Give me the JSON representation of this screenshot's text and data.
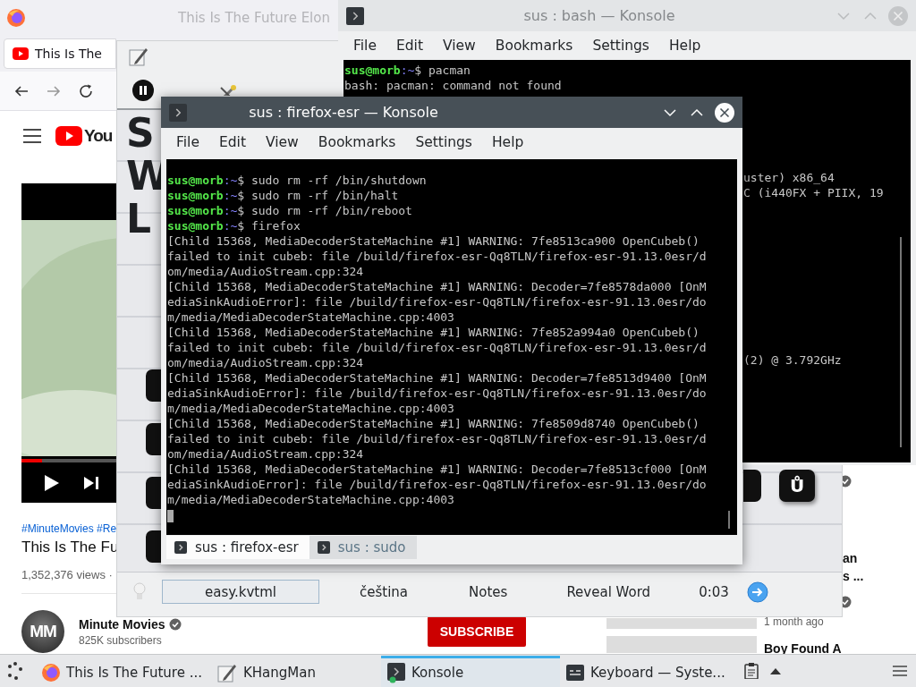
{
  "firefox": {
    "title": "This Is The Future Elon",
    "tab": "This Is The",
    "youtube": {
      "logo": "You",
      "video": {
        "kind": "picture",
        "level": 0.22
      },
      "hashtags": "#MinuteMovies #Re",
      "title": "This Is The Fu",
      "views": "1,352,376 views ·",
      "channel": {
        "avatar": "MM",
        "name": "Minute Movies",
        "verified": true,
        "subscribers": "825K subscribers"
      },
      "subscribe": "SUBSCRIBE",
      "sidebar": [
        {
          "verified": true
        },
        {
          "title_lines": [
            "an",
            "s ..."
          ],
          "verified": true,
          "age": "1 month ago"
        },
        {
          "title_lines": [
            "Boy Found A"
          ],
          "verified": false
        }
      ]
    }
  },
  "khangman": {
    "hint_words": [
      "S",
      "W",
      "L"
    ],
    "keys": [
      {
        "letter": "Ů"
      }
    ],
    "bottom_bar": {
      "file": "easy.kvtml",
      "language": "čeština",
      "notes": "Notes",
      "reveal": "Reveal Word",
      "timer": "0:03"
    }
  },
  "bash_konsole": {
    "title": "sus : bash — Konsole",
    "active": false,
    "menu": [
      "File",
      "Edit",
      "View",
      "Bookmarks",
      "Settings",
      "Help"
    ],
    "lines": [
      {
        "kind": "prompt",
        "user": "sus@morb",
        "path": ":~",
        "text": "$ pacman"
      },
      {
        "kind": "output",
        "text": "bash: pacman: command not found"
      }
    ],
    "fragments": [
      "uster) x86_64",
      "C (i440FX + PIIX, 19",
      "(2) @ 3.792GHz"
    ]
  },
  "front_konsole": {
    "title": "sus : firefox-esr — Konsole",
    "active": true,
    "menu": [
      "File",
      "Edit",
      "View",
      "Bookmarks",
      "Settings",
      "Help"
    ],
    "lines": [
      {
        "kind": "prompt",
        "user": "sus@morb",
        "path": ":~",
        "text": "$ sudo rm -rf /bin/shutdown"
      },
      {
        "kind": "prompt",
        "user": "sus@morb",
        "path": ":~",
        "text": "$ sudo rm -rf /bin/halt"
      },
      {
        "kind": "prompt",
        "user": "sus@morb",
        "path": ":~",
        "text": "$ sudo rm -rf /bin/reboot"
      },
      {
        "kind": "prompt",
        "user": "sus@morb",
        "path": ":~",
        "text": "$ firefox"
      },
      {
        "kind": "output",
        "text": "[Child 15368, MediaDecoderStateMachine #1] WARNING: 7fe8513ca900 OpenCubeb()"
      },
      {
        "kind": "output",
        "text": "failed to init cubeb: file /build/firefox-esr-Qq8TLN/firefox-esr-91.13.0esr/d"
      },
      {
        "kind": "output",
        "text": "om/media/AudioStream.cpp:324"
      },
      {
        "kind": "output",
        "text": "[Child 15368, MediaDecoderStateMachine #1] WARNING: Decoder=7fe8578da000 [OnM"
      },
      {
        "kind": "output",
        "text": "ediaSinkAudioError]: file /build/firefox-esr-Qq8TLN/firefox-esr-91.13.0esr/do"
      },
      {
        "kind": "output",
        "text": "m/media/MediaDecoderStateMachine.cpp:4003"
      },
      {
        "kind": "output",
        "text": "[Child 15368, MediaDecoderStateMachine #1] WARNING: 7fe852a994a0 OpenCubeb()"
      },
      {
        "kind": "output",
        "text": "failed to init cubeb: file /build/firefox-esr-Qq8TLN/firefox-esr-91.13.0esr/d"
      },
      {
        "kind": "output",
        "text": "om/media/AudioStream.cpp:324"
      },
      {
        "kind": "output",
        "text": "[Child 15368, MediaDecoderStateMachine #1] WARNING: Decoder=7fe8513d9400 [OnM"
      },
      {
        "kind": "output",
        "text": "ediaSinkAudioError]: file /build/firefox-esr-Qq8TLN/firefox-esr-91.13.0esr/do"
      },
      {
        "kind": "output",
        "text": "m/media/MediaDecoderStateMachine.cpp:4003"
      },
      {
        "kind": "output",
        "text": "[Child 15368, MediaDecoderStateMachine #1] WARNING: 7fe8509d8740 OpenCubeb()"
      },
      {
        "kind": "output",
        "text": "failed to init cubeb: file /build/firefox-esr-Qq8TLN/firefox-esr-91.13.0esr/d"
      },
      {
        "kind": "output",
        "text": "om/media/AudioStream.cpp:324"
      },
      {
        "kind": "output",
        "text": "[Child 15368, MediaDecoderStateMachine #1] WARNING: Decoder=7fe8513cf000 [OnM"
      },
      {
        "kind": "output",
        "text": "ediaSinkAudioError]: file /build/firefox-esr-Qq8TLN/firefox-esr-91.13.0esr/do"
      },
      {
        "kind": "output",
        "text": "m/media/MediaDecoderStateMachine.cpp:4003"
      }
    ],
    "tabs": [
      {
        "label": "sus : firefox-esr",
        "selected": true
      },
      {
        "label": "sus : sudo",
        "selected": false
      }
    ]
  },
  "taskbar": {
    "tasks": [
      {
        "kind": "browser",
        "label": "This Is The Future ...",
        "selected": false
      },
      {
        "kind": "game",
        "label": "KHangMan",
        "selected": false
      },
      {
        "kind": "terminal",
        "label": "Konsole",
        "selected": true
      },
      {
        "kind": "settings",
        "label": "Keyboard — Syste...",
        "selected": false
      }
    ]
  }
}
